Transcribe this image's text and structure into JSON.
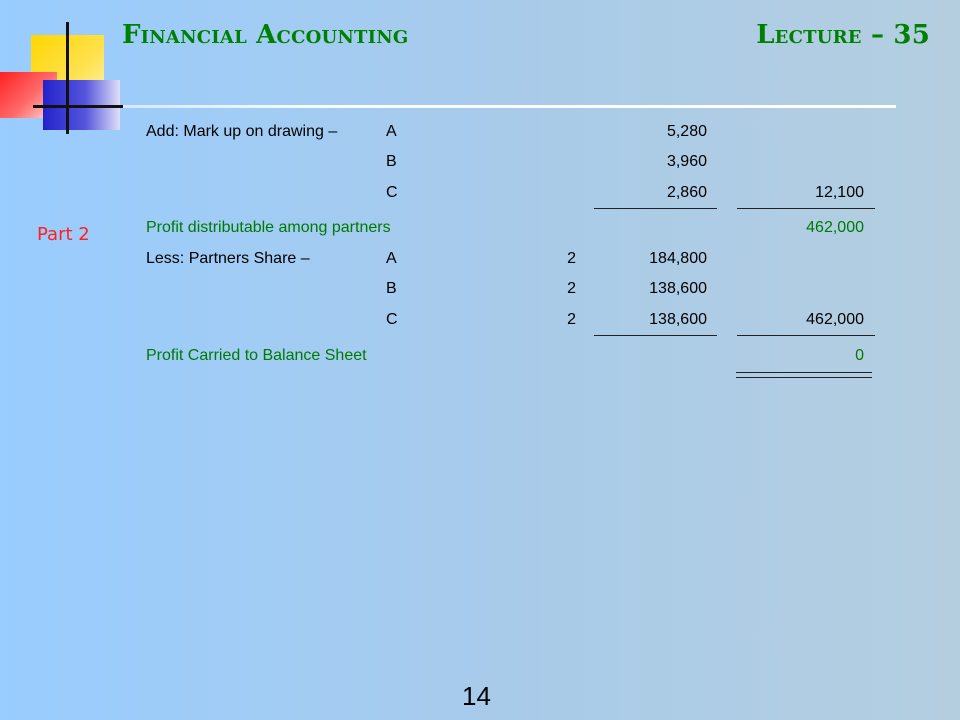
{
  "header": {
    "title_left": "Financial Accounting",
    "title_right": "Lecture – 35"
  },
  "side_label": "Part 2",
  "page_number": "14",
  "statement": {
    "add_label": "Add: Mark up on drawing –",
    "markup": [
      {
        "partner": "A",
        "amount": "5,280"
      },
      {
        "partner": "B",
        "amount": "3,960"
      },
      {
        "partner": "C",
        "amount": "2,860"
      }
    ],
    "markup_total": "12,100",
    "profit_distributable_label": "Profit distributable among partners",
    "profit_distributable_total": "462,000",
    "less_label": "Less: Partners Share –",
    "shares": [
      {
        "partner": "A",
        "ratio": "2",
        "amount": "184,800"
      },
      {
        "partner": "B",
        "ratio": "2",
        "amount": "138,600"
      },
      {
        "partner": "C",
        "ratio": "2",
        "amount": "138,600"
      }
    ],
    "shares_total": "462,000",
    "carried_label": "Profit Carried to Balance Sheet",
    "carried_total": "0"
  },
  "colors": {
    "title": "#008000",
    "green_text": "#007a00",
    "part_label": "#ff2020",
    "background_left": "#99ccff",
    "background_right": "#b4cee0"
  }
}
